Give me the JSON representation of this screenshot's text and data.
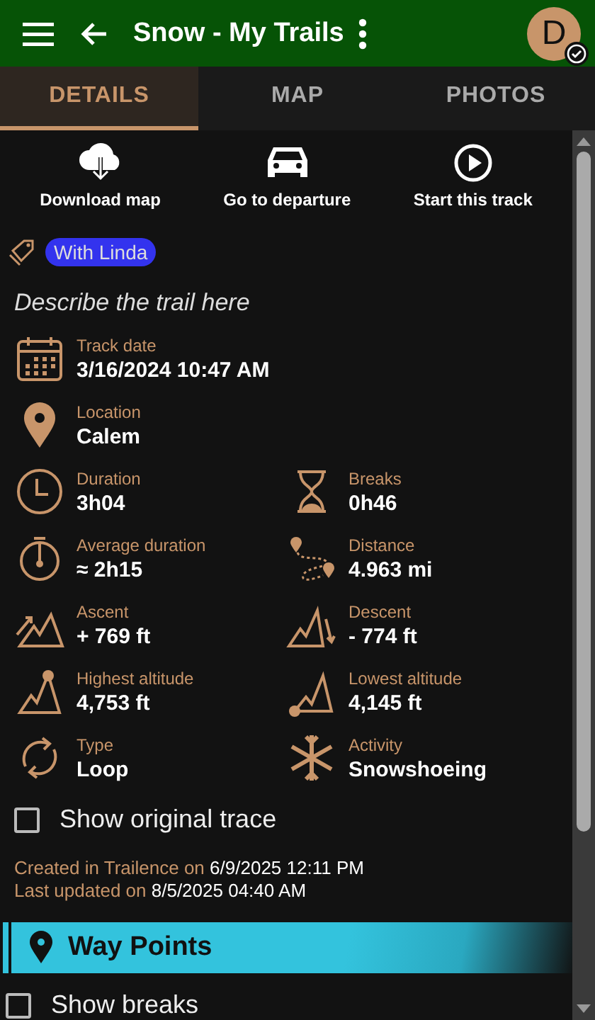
{
  "app_bar": {
    "title": "Snow - My Trails",
    "avatar_letter": "D",
    "synced": true
  },
  "tabs": [
    {
      "label": "DETAILS",
      "selected": true
    },
    {
      "label": "MAP",
      "selected": false
    },
    {
      "label": "PHOTOS",
      "selected": false
    }
  ],
  "actions": [
    {
      "kind": "download",
      "label": "Download map"
    },
    {
      "kind": "car",
      "label": "Go to departure"
    },
    {
      "kind": "play",
      "label": "Start this track"
    }
  ],
  "tags": [
    {
      "label": "With Linda",
      "color": "#3333ee"
    }
  ],
  "description": "Describe the trail here",
  "details": [
    [
      {
        "kind": "calendar",
        "label": "Track date",
        "value": "3/16/2024 10:47 AM"
      }
    ],
    [
      {
        "kind": "pin",
        "label": "Location",
        "value": "Calem"
      }
    ],
    [
      {
        "kind": "clock",
        "label": "Duration",
        "value": "3h04"
      },
      {
        "kind": "hourglass",
        "label": "Breaks",
        "value": "0h46"
      }
    ],
    [
      {
        "kind": "stopwatch",
        "label": "Average duration",
        "value": "≈ 2h15"
      },
      {
        "kind": "route",
        "label": "Distance",
        "value": "4.963 mi"
      }
    ],
    [
      {
        "kind": "ascent",
        "label": "Ascent",
        "value": "+ 769 ft"
      },
      {
        "kind": "descent",
        "label": "Descent",
        "value": "- 774 ft"
      }
    ],
    [
      {
        "kind": "highest",
        "label": "Highest altitude",
        "value": "4,753 ft"
      },
      {
        "kind": "lowest",
        "label": "Lowest altitude",
        "value": "4,145 ft"
      }
    ],
    [
      {
        "kind": "loop",
        "label": "Type",
        "value": "Loop"
      },
      {
        "kind": "snow",
        "label": "Activity",
        "value": "Snowshoeing"
      }
    ]
  ],
  "show_original_trace": {
    "label": "Show original trace",
    "checked": false
  },
  "created": {
    "label": "Created in Trailence on",
    "value": "6/9/2025 12:11 PM"
  },
  "updated": {
    "label": "Last updated on",
    "value": "8/5/2025 04:40 AM"
  },
  "way_points": {
    "title": "Way Points",
    "expanded": true
  },
  "show_breaks": {
    "label": "Show breaks",
    "checked": false
  }
}
